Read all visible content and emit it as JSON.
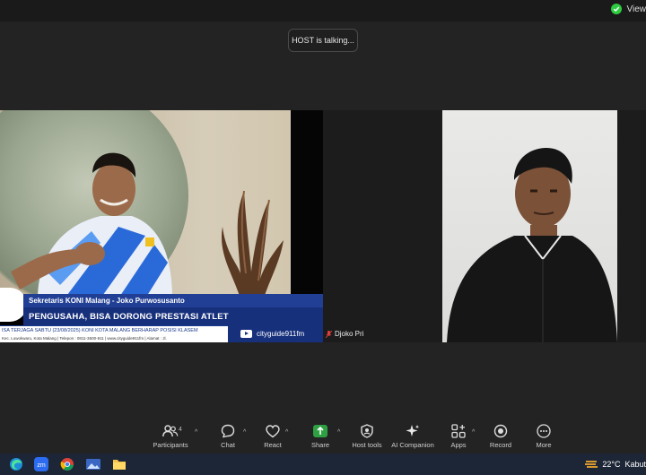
{
  "top_bar": {
    "view_label": "View"
  },
  "toast": {
    "text": "HOST is talking..."
  },
  "video_left": {
    "lower_third": {
      "name_line": "Sekretaris KONI Malang - Joko Purwosusanto",
      "headline": "PENGUSAHA, BISA DORONG PRESTASI ATLET",
      "ticker": "ISA TERJAGA     SABTU (23/08/2025) KONI KOTA MALANG BERHARAP POSISI KLASEM",
      "address": "Kec. Lowokwaru, Kota Malang | Telepon : 0811-3600-911 | www.cityguide911fm | Alamat : Jl.",
      "brand": "cityguide911fm"
    }
  },
  "video_right": {
    "participant_name": "Djoko Pri"
  },
  "toolbar": {
    "participants_label": "Participants",
    "participants_count": "4",
    "chat_label": "Chat",
    "react_label": "React",
    "share_label": "Share",
    "host_tools_label": "Host tools",
    "ai_companion_label": "AI Companion",
    "apps_label": "Apps",
    "record_label": "Record",
    "more_label": "More"
  },
  "taskbar": {
    "temperature": "22°C",
    "weather_text": "Kabut"
  },
  "colors": {
    "accent_share": "#2ea043",
    "banner_blue": "#17307c",
    "shield_green": "#2ecc40"
  }
}
